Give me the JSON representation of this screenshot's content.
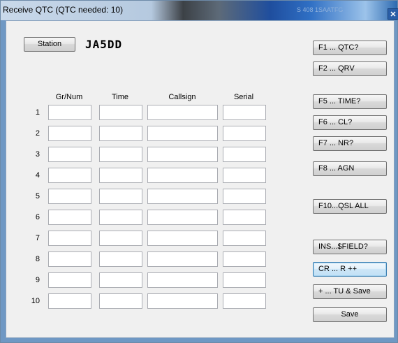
{
  "window": {
    "title": "Receive QTC (QTC needed: 10)",
    "title_ghost": "S 408 1SAATFG",
    "close_glyph": "✕"
  },
  "station": {
    "button_label": "Station",
    "value": "JA5DD"
  },
  "columns": [
    "Gr/Num",
    "Time",
    "Callsign",
    "Serial"
  ],
  "rows": [
    {
      "num": "1"
    },
    {
      "num": "2"
    },
    {
      "num": "3"
    },
    {
      "num": "4"
    },
    {
      "num": "5"
    },
    {
      "num": "6"
    },
    {
      "num": "7"
    },
    {
      "num": "8"
    },
    {
      "num": "9"
    },
    {
      "num": "10"
    }
  ],
  "function_buttons": [
    {
      "label": "F1 ... QTC?"
    },
    {
      "label": "F2 ... QRV"
    },
    {
      "label": "F5 ... TIME?"
    },
    {
      "label": "F6 ... CL?"
    },
    {
      "label": "F7 ... NR?"
    },
    {
      "label": "F8 ... AGN"
    },
    {
      "label": "F10...QSL ALL"
    },
    {
      "label": "INS...$FIELD?"
    },
    {
      "label": "CR ... R ++"
    },
    {
      "label": "+ ... TU & Save"
    },
    {
      "label": "Save"
    }
  ]
}
